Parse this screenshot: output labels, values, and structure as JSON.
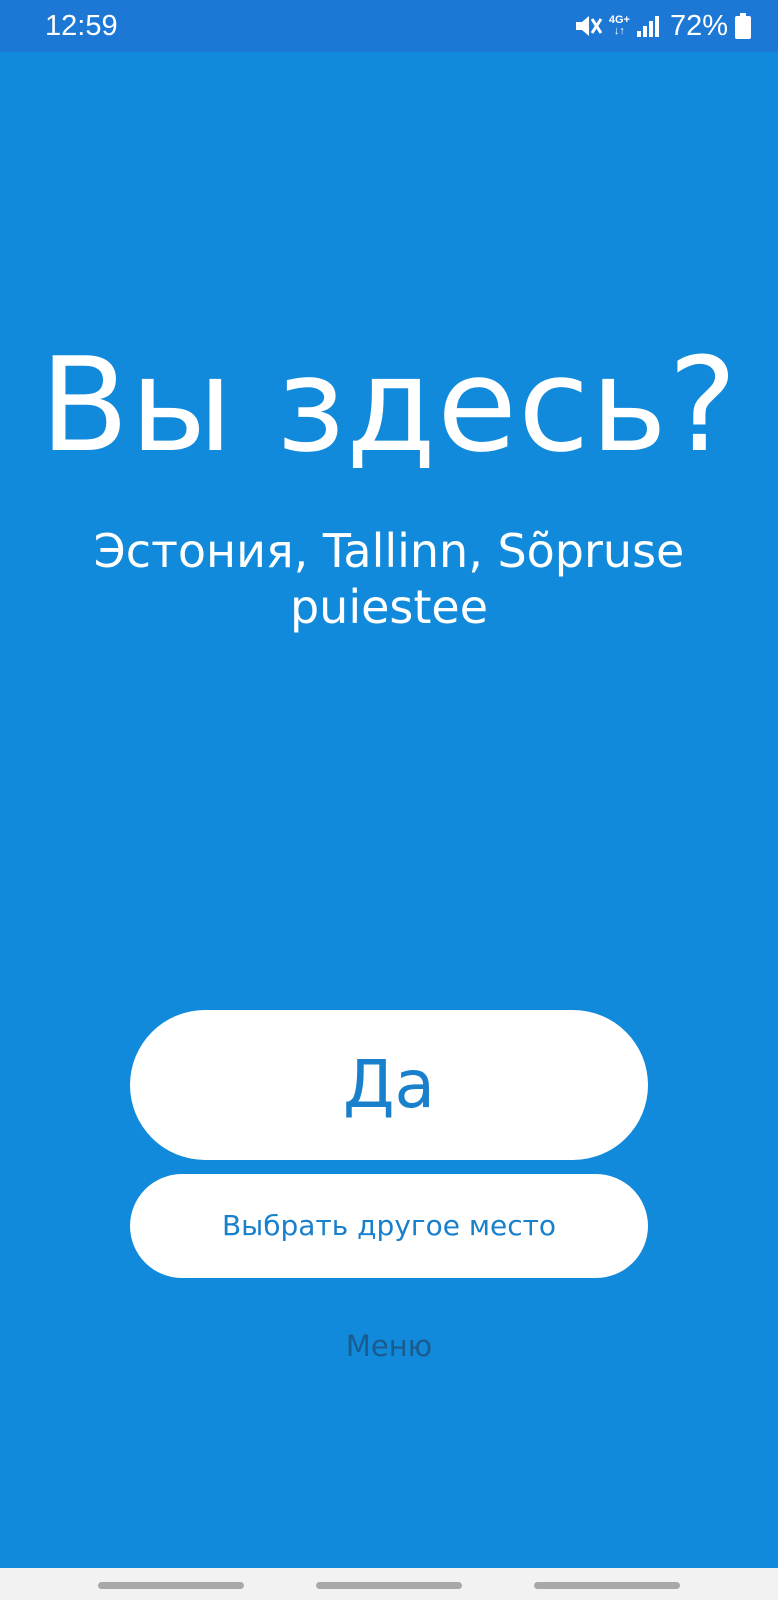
{
  "status_bar": {
    "time": "12:59",
    "network": "4G+",
    "battery_percent": "72%",
    "icons": [
      "mute-icon",
      "network-4g-icon",
      "signal-icon",
      "battery-icon"
    ],
    "background_color": "#1C78D4"
  },
  "screen": {
    "background_color": "#118ADB",
    "title": "Вы здесь?",
    "address": "Эстония, Tallinn, Sõpruse puiestee"
  },
  "actions": {
    "yes_label": "Да",
    "other_place_label": "Выбрать другое место",
    "menu_label": "Меню",
    "button_text_color": "#1980CC"
  },
  "navigation_bar": {
    "icons": [
      "nav-handle-left",
      "nav-handle-center",
      "nav-handle-right"
    ]
  }
}
